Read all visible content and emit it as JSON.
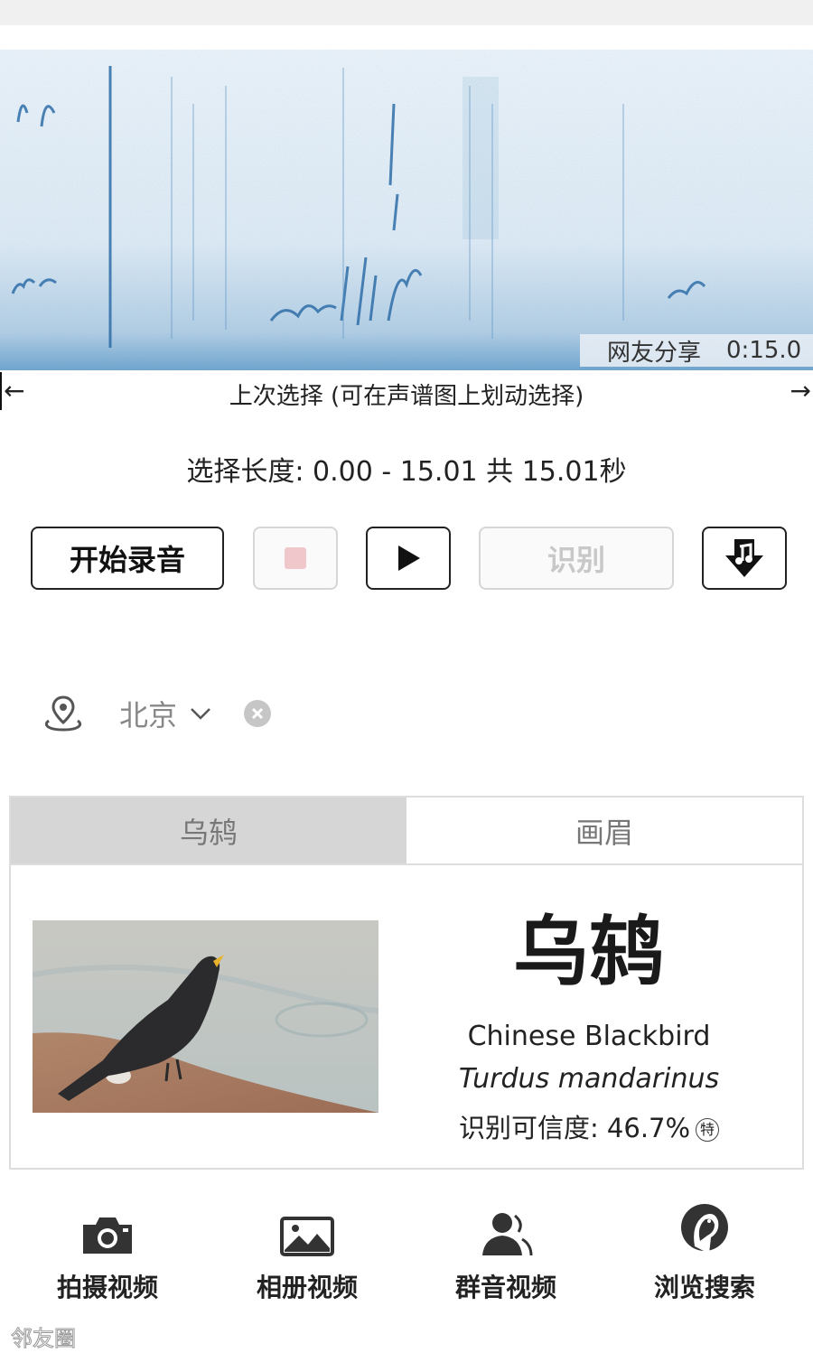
{
  "spectrogram": {
    "source_label": "网友分享",
    "duration": "0:15.0",
    "icon": "spectrogram-image",
    "accent_color": "#2f7bb8"
  },
  "selection": {
    "left_arrow": "←",
    "right_arrow": "→",
    "caption": "上次选择 (可在声谱图上划动选择)",
    "length_text": "选择长度: 0.00 - 15.01 共 15.01秒"
  },
  "controls": {
    "record_label": "开始录音",
    "identify_label": "识别",
    "stop_icon": "stop-icon",
    "play_icon": "play-icon",
    "music_icon": "music-download-icon"
  },
  "location": {
    "icon": "location-pin-icon",
    "city": "北京"
  },
  "tabs": [
    {
      "label": "乌鸫",
      "active": true
    },
    {
      "label": "画眉",
      "active": false
    }
  ],
  "result": {
    "chinese_name": "乌鸫",
    "english_name": "Chinese Blackbird",
    "scientific_name": "Turdus mandarinus",
    "confidence_text": "识别可信度: 46.7%",
    "special_mark": "特"
  },
  "bottom_nav": [
    {
      "label": "拍摄视频",
      "icon": "camera-icon"
    },
    {
      "label": "相册视频",
      "icon": "gallery-icon"
    },
    {
      "label": "群音视频",
      "icon": "group-audio-icon"
    },
    {
      "label": "浏览搜索",
      "icon": "parrot-browse-icon"
    }
  ],
  "watermark": "邻友圈"
}
